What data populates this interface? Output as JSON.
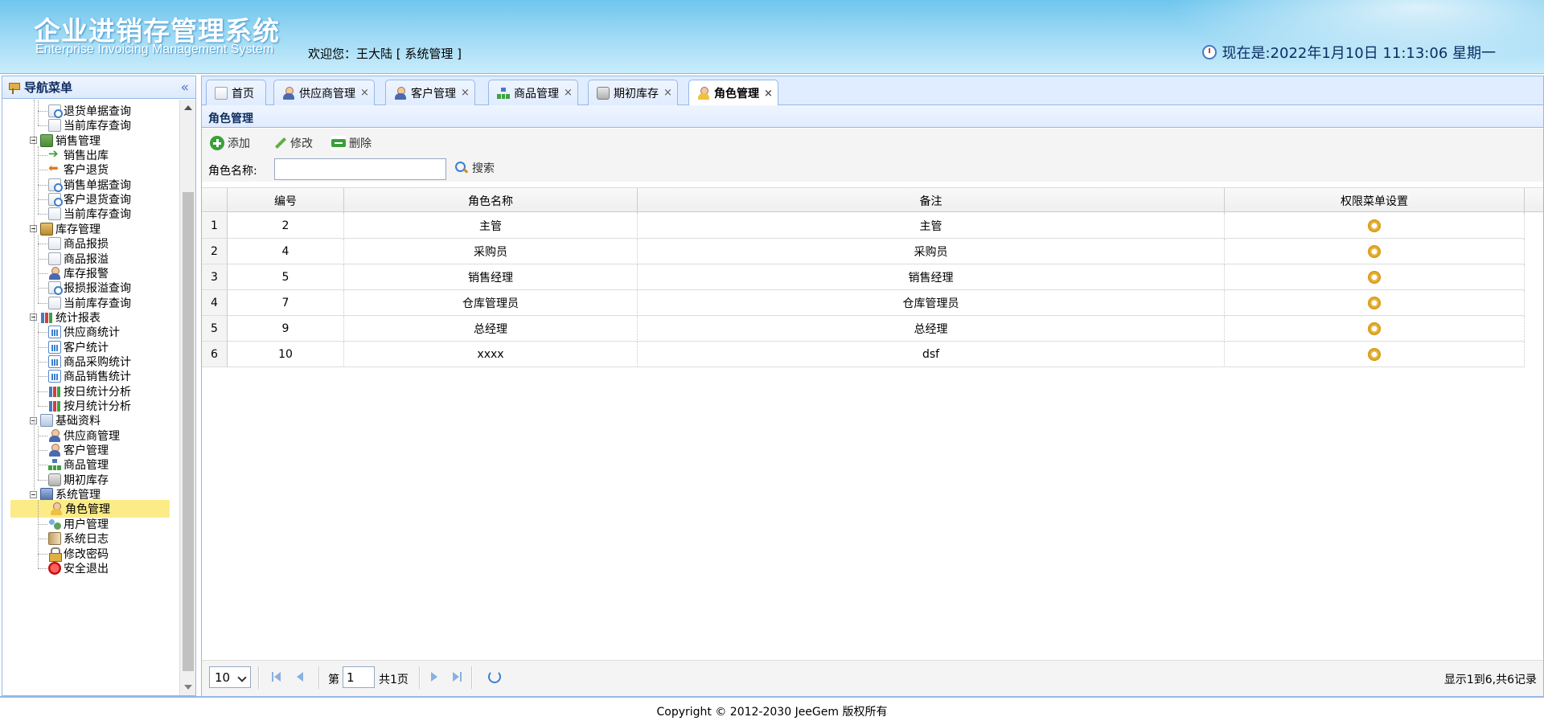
{
  "header": {
    "title_cn": "企业进销存管理系统",
    "title_en": "Enterprise Invoicing Management System",
    "welcome": "欢迎您：王大陆 [ 系统管理 ]",
    "clock": "现在是:2022年1月10日 11:13:06 星期一"
  },
  "sidebar": {
    "title": "导航菜单",
    "items": [
      {
        "label": "退货单据查询",
        "icon": "search-doc-icon",
        "level": 2
      },
      {
        "label": "当前库存查询",
        "icon": "doc-icon",
        "level": 2
      },
      {
        "label": "销售管理",
        "icon": "folder-icon",
        "level": 1
      },
      {
        "label": "销售出库",
        "icon": "arrow-right-icon",
        "level": 2
      },
      {
        "label": "客户退货",
        "icon": "arrow-left-icon",
        "level": 2
      },
      {
        "label": "销售单据查询",
        "icon": "search-doc-icon",
        "level": 2
      },
      {
        "label": "客户退货查询",
        "icon": "search-doc-icon",
        "level": 2
      },
      {
        "label": "当前库存查询",
        "icon": "doc-icon",
        "level": 2
      },
      {
        "label": "库存管理",
        "icon": "folder-icon",
        "level": 1
      },
      {
        "label": "商品报损",
        "icon": "doc-icon",
        "level": 2
      },
      {
        "label": "商品报溢",
        "icon": "doc-icon",
        "level": 2
      },
      {
        "label": "库存报警",
        "icon": "user-icon",
        "level": 2
      },
      {
        "label": "报损报溢查询",
        "icon": "search-doc-icon",
        "level": 2
      },
      {
        "label": "当前库存查询",
        "icon": "doc-icon",
        "level": 2
      },
      {
        "label": "统计报表",
        "icon": "bar-chart-icon",
        "level": 1
      },
      {
        "label": "供应商统计",
        "icon": "chart-icon",
        "level": 2
      },
      {
        "label": "客户统计",
        "icon": "chart-icon",
        "level": 2
      },
      {
        "label": "商品采购统计",
        "icon": "chart-icon",
        "level": 2
      },
      {
        "label": "商品销售统计",
        "icon": "chart-icon",
        "level": 2
      },
      {
        "label": "按日统计分析",
        "icon": "bar-chart-icon",
        "level": 2
      },
      {
        "label": "按月统计分析",
        "icon": "bar-chart-icon",
        "level": 2
      },
      {
        "label": "基础资料",
        "icon": "base-data-icon",
        "level": 1
      },
      {
        "label": "供应商管理",
        "icon": "user-icon",
        "level": 2
      },
      {
        "label": "客户管理",
        "icon": "user-icon",
        "level": 2
      },
      {
        "label": "商品管理",
        "icon": "tree-icon",
        "level": 2
      },
      {
        "label": "期初库存",
        "icon": "database-icon",
        "level": 2
      },
      {
        "label": "系统管理",
        "icon": "system-icon",
        "level": 1
      },
      {
        "label": "角色管理",
        "icon": "user-icon",
        "level": 2,
        "selected": true
      },
      {
        "label": "用户管理",
        "icon": "users-icon",
        "level": 2
      },
      {
        "label": "系统日志",
        "icon": "book-icon",
        "level": 2
      },
      {
        "label": "修改密码",
        "icon": "lock-icon",
        "level": 2
      },
      {
        "label": "安全退出",
        "icon": "exit-icon",
        "level": 2
      }
    ]
  },
  "tabs": [
    {
      "label": "首页",
      "closable": false
    },
    {
      "label": "供应商管理",
      "closable": true
    },
    {
      "label": "客户管理",
      "closable": true
    },
    {
      "label": "商品管理",
      "closable": true
    },
    {
      "label": "期初库存",
      "closable": true
    },
    {
      "label": "角色管理",
      "closable": true,
      "active": true
    }
  ],
  "close_glyph": "×",
  "panel": {
    "title": "角色管理",
    "toolbar": {
      "add": "添加",
      "edit": "修改",
      "delete": "删除"
    },
    "search_label": "角色名称:",
    "search_value": "",
    "search_button": "搜索"
  },
  "grid": {
    "columns": [
      "编号",
      "角色名称",
      "备注",
      "权限菜单设置"
    ],
    "rows": [
      {
        "num": "1",
        "id": "2",
        "name": "主管",
        "remark": "主管"
      },
      {
        "num": "2",
        "id": "4",
        "name": "采购员",
        "remark": "采购员"
      },
      {
        "num": "3",
        "id": "5",
        "name": "销售经理",
        "remark": "销售经理"
      },
      {
        "num": "4",
        "id": "7",
        "name": "仓库管理员",
        "remark": "仓库管理员"
      },
      {
        "num": "5",
        "id": "9",
        "name": "总经理",
        "remark": "总经理"
      },
      {
        "num": "6",
        "id": "10",
        "name": "xxxx",
        "remark": "dsf"
      }
    ]
  },
  "pager": {
    "page_size": "10",
    "page_prefix": "第",
    "current_page": "1",
    "page_suffix": "共1页",
    "info": "显示1到6,共6记录"
  },
  "footer": "Copyright © 2012-2030 JeeGem 版权所有"
}
